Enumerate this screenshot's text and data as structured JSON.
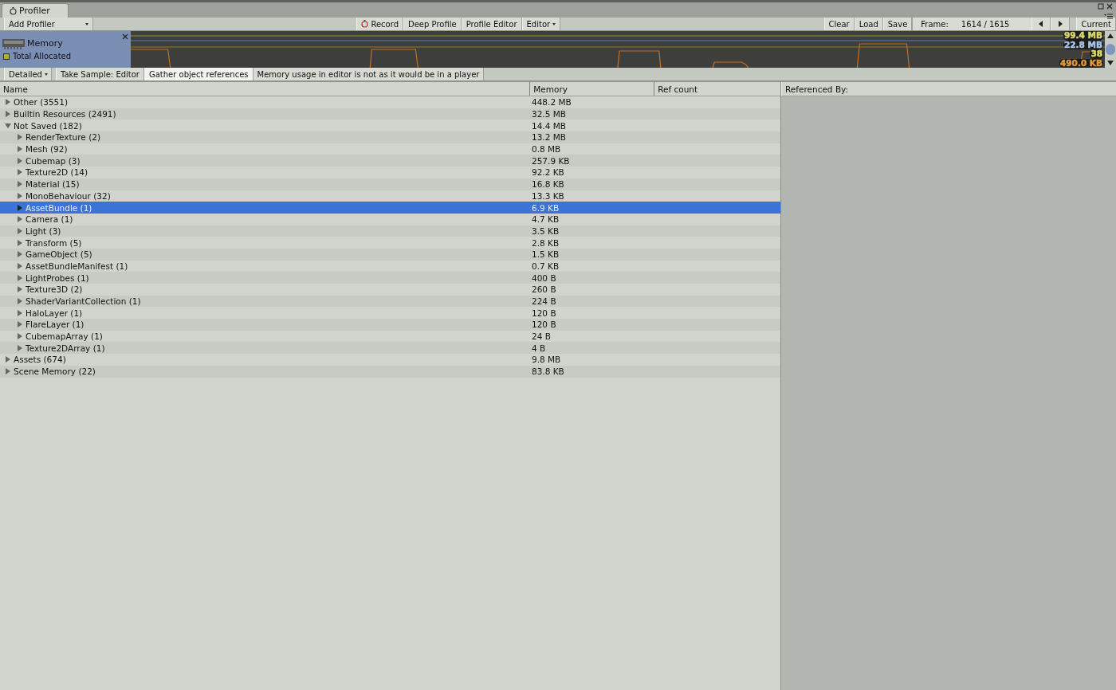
{
  "window": {
    "tab": "Profiler"
  },
  "toolbar": {
    "add_profiler": "Add Profiler",
    "buttons": [
      {
        "label": "Record",
        "kind": "record",
        "selected": false
      },
      {
        "label": "Deep Profile",
        "kind": "plain",
        "selected": false
      },
      {
        "label": "Profile Editor",
        "kind": "plain",
        "selected": false
      },
      {
        "label": "Editor",
        "kind": "dropdown",
        "selected": false
      }
    ],
    "right_buttons": [
      "Clear",
      "Load",
      "Save"
    ],
    "frame_label": "Frame:",
    "frame_value": "1614 / 1615",
    "current": "Current"
  },
  "area": {
    "title": "Memory",
    "legend": [
      {
        "label": "Total Allocated",
        "color": "#a8b820"
      }
    ],
    "readings": [
      "99.4 MB",
      "22.8 MB",
      "38",
      "490.0 KB"
    ]
  },
  "subtoolbar": {
    "mode": "Detailed",
    "buttons": [
      {
        "label": "Take Sample: Editor",
        "selected": false
      },
      {
        "label": "Gather object references",
        "selected": true
      }
    ],
    "note": "Memory usage in editor is not as it would be in a player"
  },
  "table": {
    "columns": [
      "Name",
      "Memory",
      "Ref count"
    ],
    "rows": [
      {
        "name": "Other (3551)",
        "memory": "448.2 MB",
        "expanded": false,
        "selected": false
      },
      {
        "name": "Builtin Resources (2491)",
        "memory": "32.5 MB",
        "expanded": false,
        "selected": false
      },
      {
        "name": "Not Saved (182)",
        "memory": "14.4 MB",
        "expanded": true,
        "selected": false,
        "children": [
          {
            "name": "RenderTexture (2)",
            "memory": "13.2 MB",
            "expanded": false,
            "selected": false
          },
          {
            "name": "Mesh (92)",
            "memory": "0.8 MB",
            "expanded": false,
            "selected": false
          },
          {
            "name": "Cubemap (3)",
            "memory": "257.9 KB",
            "expanded": false,
            "selected": false
          },
          {
            "name": "Texture2D (14)",
            "memory": "92.2 KB",
            "expanded": false,
            "selected": false
          },
          {
            "name": "Material (15)",
            "memory": "16.8 KB",
            "expanded": false,
            "selected": false
          },
          {
            "name": "MonoBehaviour (32)",
            "memory": "13.3 KB",
            "expanded": false,
            "selected": false
          },
          {
            "name": "AssetBundle (1)",
            "memory": "6.9 KB",
            "expanded": false,
            "selected": true
          },
          {
            "name": "Camera (1)",
            "memory": "4.7 KB",
            "expanded": false,
            "selected": false
          },
          {
            "name": "Light (3)",
            "memory": "3.5 KB",
            "expanded": false,
            "selected": false
          },
          {
            "name": "Transform (5)",
            "memory": "2.8 KB",
            "expanded": false,
            "selected": false
          },
          {
            "name": "GameObject (5)",
            "memory": "1.5 KB",
            "expanded": false,
            "selected": false
          },
          {
            "name": "AssetBundleManifest (1)",
            "memory": "0.7 KB",
            "expanded": false,
            "selected": false
          },
          {
            "name": "LightProbes (1)",
            "memory": "400 B",
            "expanded": false,
            "selected": false
          },
          {
            "name": "Texture3D (2)",
            "memory": "260 B",
            "expanded": false,
            "selected": false
          },
          {
            "name": "ShaderVariantCollection (1)",
            "memory": "224 B",
            "expanded": false,
            "selected": false
          },
          {
            "name": "HaloLayer (1)",
            "memory": "120 B",
            "expanded": false,
            "selected": false
          },
          {
            "name": "FlareLayer (1)",
            "memory": "120 B",
            "expanded": false,
            "selected": false
          },
          {
            "name": "CubemapArray (1)",
            "memory": "24 B",
            "expanded": false,
            "selected": false
          },
          {
            "name": "Texture2DArray (1)",
            "memory": "4 B",
            "expanded": false,
            "selected": false
          }
        ]
      },
      {
        "name": "Assets (674)",
        "memory": "9.8 MB",
        "expanded": false,
        "selected": false
      },
      {
        "name": "Scene Memory (22)",
        "memory": "83.8 KB",
        "expanded": false,
        "selected": false
      }
    ]
  },
  "referenced_by": {
    "title": "Referenced By:"
  }
}
